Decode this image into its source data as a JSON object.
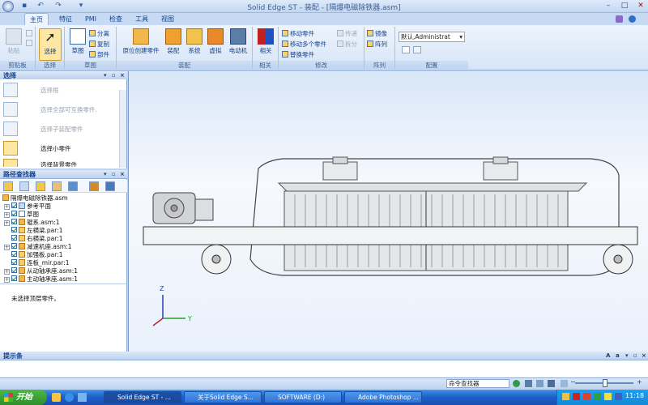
{
  "window": {
    "title": "Solid Edge ST - 装配 - [隔爆电磁除铁器.asm]",
    "controls": [
      "–",
      "□",
      "✕"
    ]
  },
  "ribbon": {
    "tabs": [
      "主页",
      "特征",
      "PMI",
      "检查",
      "工具",
      "视图"
    ],
    "groups": {
      "clipboard": {
        "label": "剪贴板",
        "paste": "粘贴"
      },
      "select": {
        "label": "选择",
        "select": "选择"
      },
      "sketch": {
        "label": "草图",
        "sketch": "草图",
        "split": "分离",
        "copy": "复制",
        "part": "部件"
      },
      "assembly": {
        "label": "装配",
        "inplace": "原位创建零件",
        "assemble": "装配",
        "system": "系统",
        "virtual": "虚拟",
        "motor": "电动机"
      },
      "relate": {
        "label": "相关",
        "relate": "相关"
      },
      "modify": {
        "label": "修改",
        "move_part": "移动零件",
        "move_multi": "移动多个零件",
        "replace": "替换零件",
        "transfer": "传递",
        "disperse": "拆分"
      },
      "pattern": {
        "label": "阵列",
        "mirror": "镜像",
        "pattern": "阵列"
      },
      "config": {
        "label": "配置",
        "value": "默认,Administrat"
      }
    }
  },
  "select_panel": {
    "title": "选择",
    "items": [
      {
        "label": "选择框",
        "active": false
      },
      {
        "label": "选择全部可互换零件.",
        "active": false
      },
      {
        "label": "选择子装配零件",
        "active": false
      },
      {
        "label": "选择小零件",
        "active": true
      },
      {
        "label": "选择背景零件",
        "active": true
      }
    ]
  },
  "path_finder": {
    "title": "路径查找器",
    "tree": [
      {
        "label": "隔爆电磁除铁器.asm",
        "level": 0,
        "expander": ""
      },
      {
        "label": "参考平面",
        "level": 1,
        "expander": "+"
      },
      {
        "label": "草图",
        "level": 1,
        "expander": "+"
      },
      {
        "label": "辊系.asm:1",
        "level": 1,
        "expander": "+"
      },
      {
        "label": "左横梁.par:1",
        "level": 1,
        "expander": ""
      },
      {
        "label": "右横梁.par:1",
        "level": 1,
        "expander": ""
      },
      {
        "label": "减速机座.asm:1",
        "level": 1,
        "expander": "+"
      },
      {
        "label": "加强板.par:1",
        "level": 1,
        "expander": ""
      },
      {
        "label": "连板_mir.par:1",
        "level": 1,
        "expander": ""
      },
      {
        "label": "从动轴承座.asm:1",
        "level": 1,
        "expander": "+"
      },
      {
        "label": "主动轴承座.asm:1",
        "level": 1,
        "expander": "+"
      }
    ],
    "status": "未选择顶层零件。"
  },
  "viewport": {
    "axis_z": "Z",
    "axis_y": "Y"
  },
  "prompt_bar": {
    "title": "提示条"
  },
  "statusbar": {
    "command_finder": "命令查找器"
  },
  "taskbar": {
    "start": "开始",
    "tasks": [
      {
        "label": "Solid Edge ST - ..."
      },
      {
        "label": "关于Solid Edge S..."
      },
      {
        "label": "SOFTWARE (D:)"
      },
      {
        "label": "Adobe Photoshop ..."
      }
    ],
    "clock": "11:18"
  }
}
